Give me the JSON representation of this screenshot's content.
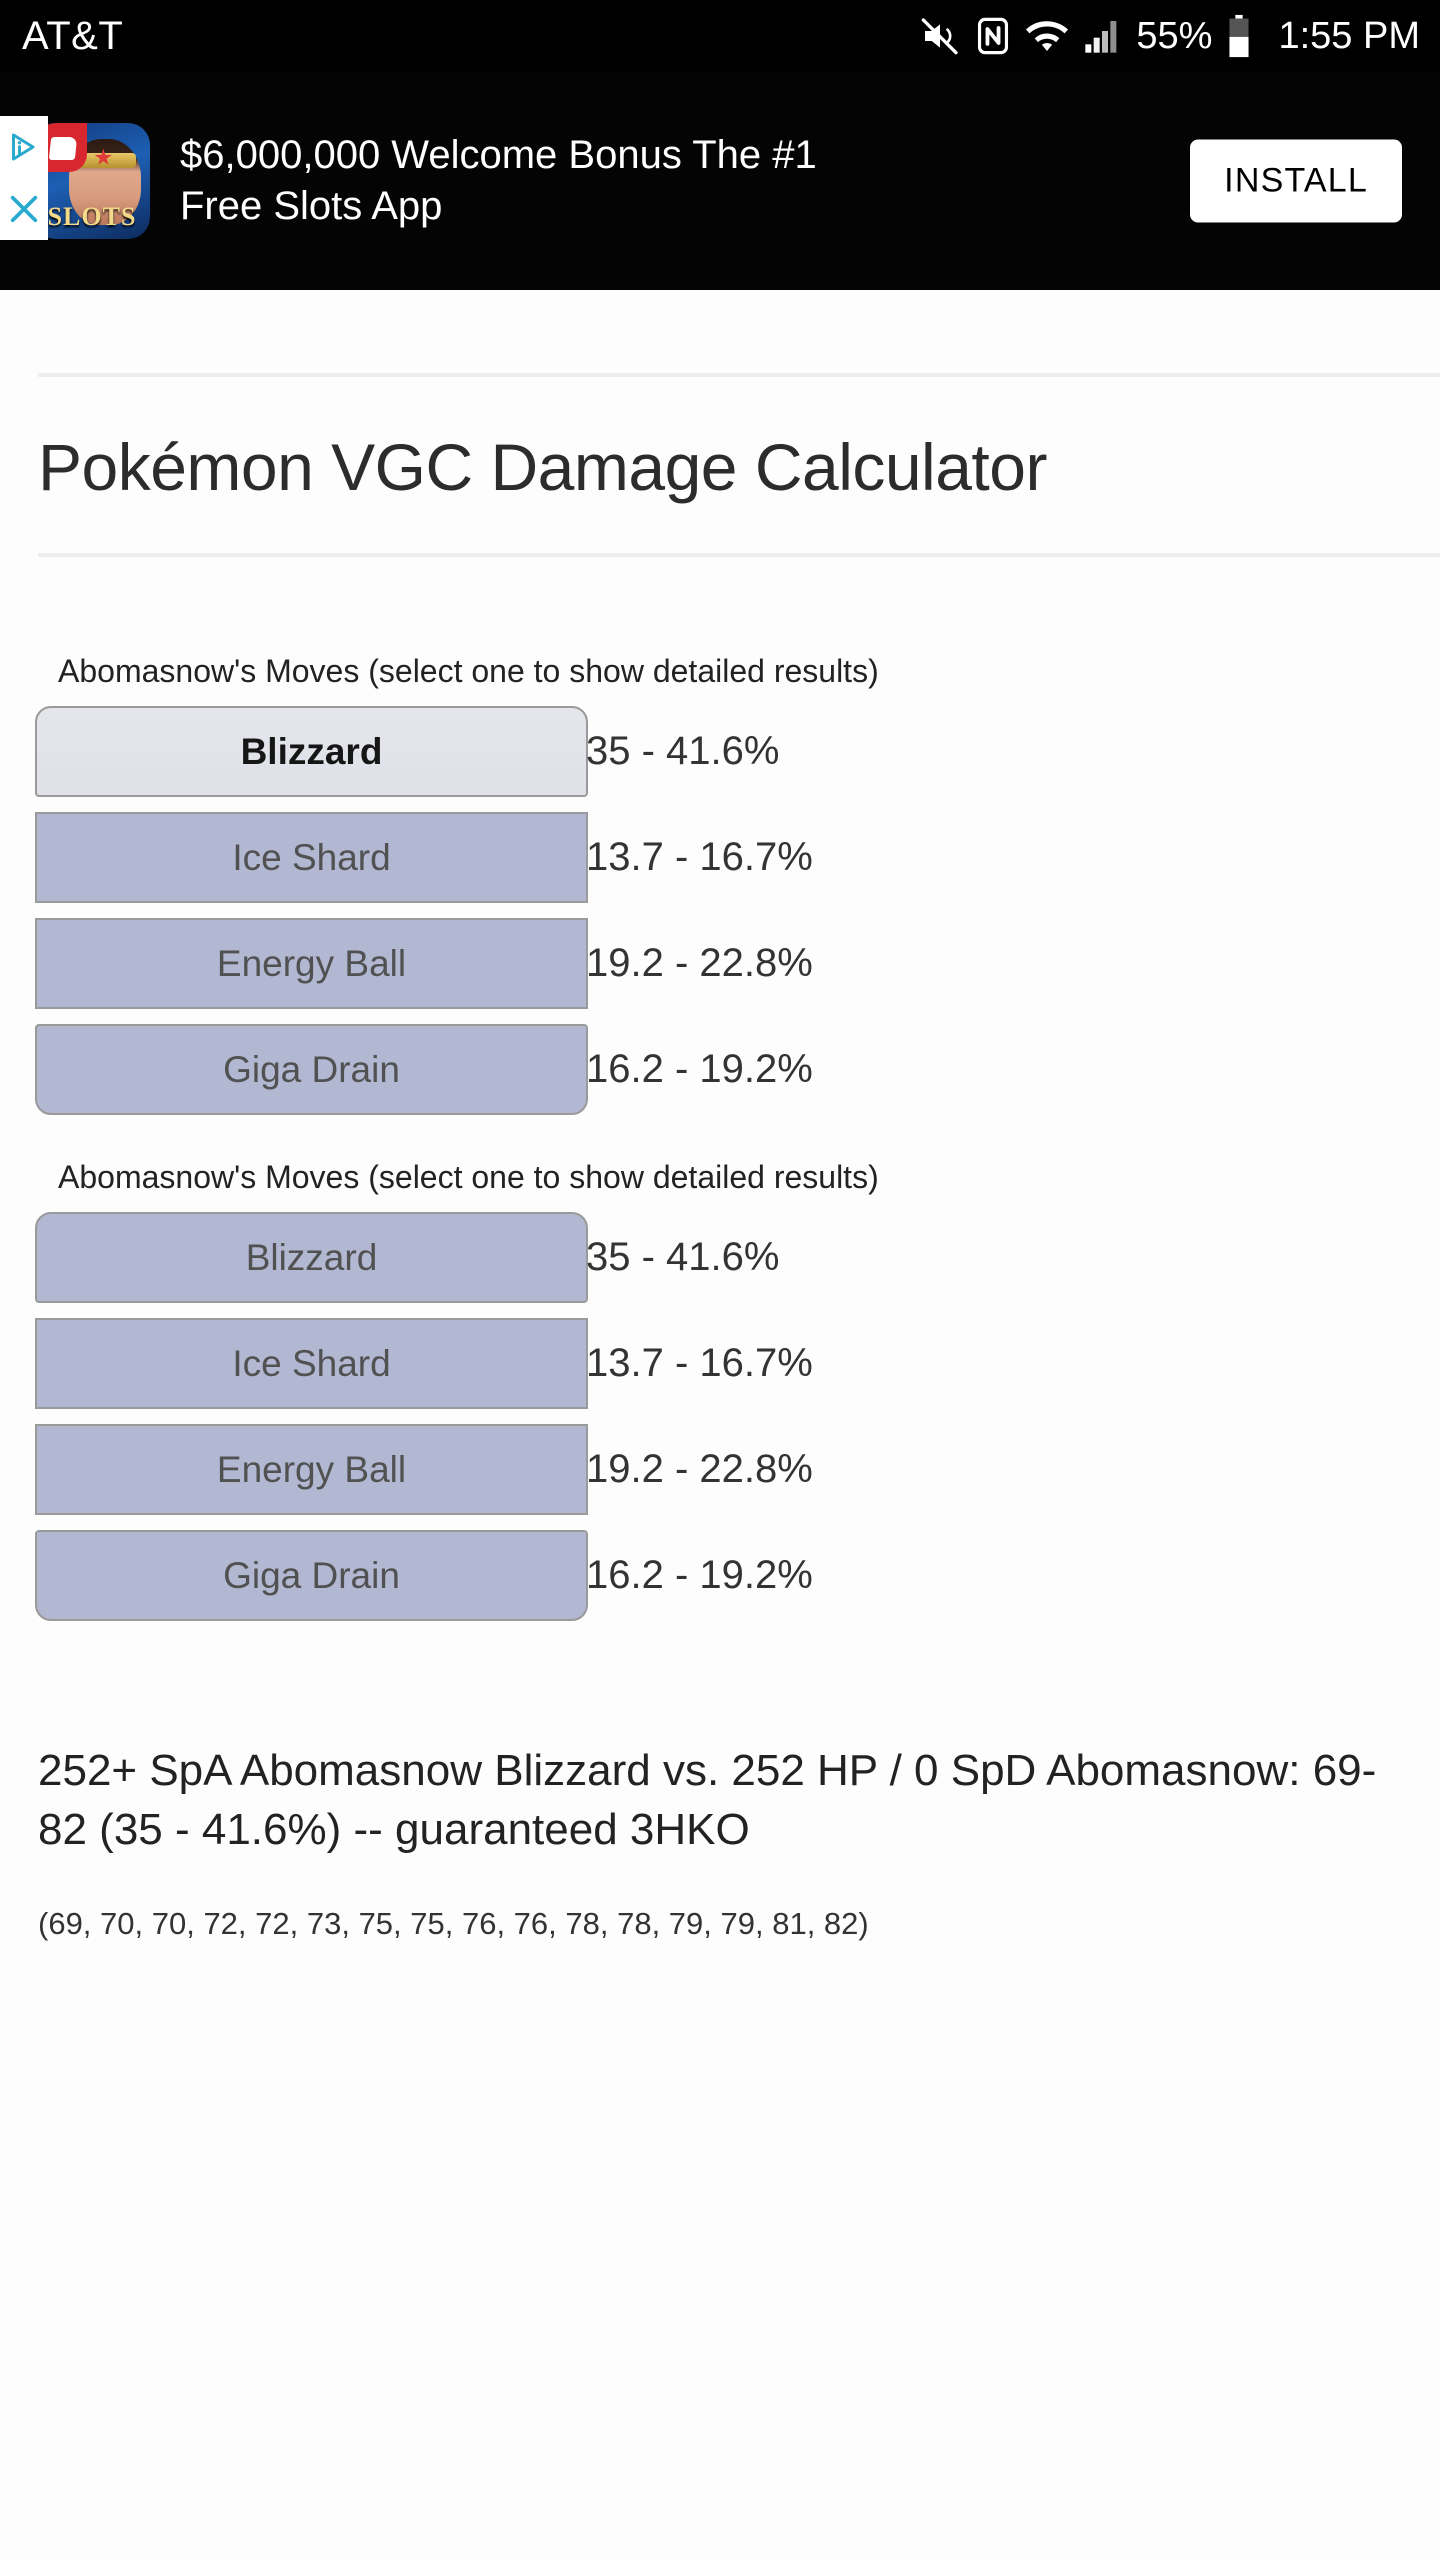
{
  "status_bar": {
    "carrier": "AT&T",
    "battery_percent": "55%",
    "time": "1:55 PM",
    "icons": [
      "mute-icon",
      "nfc-icon",
      "wifi-icon",
      "cellular-signal-icon",
      "battery-icon"
    ]
  },
  "ad": {
    "headline": "$6,000,000 Welcome Bonus The #1 Free Slots App",
    "install_label": "INSTALL",
    "app_icon_text": "SLOTS",
    "badges": [
      "adchoices-icon",
      "close-icon"
    ]
  },
  "page": {
    "title": "Pokémon VGC Damage Calculator"
  },
  "moves_sections": [
    {
      "label": "Abomasnow's Moves (select one to show detailed results)",
      "moves": [
        {
          "name": "Blizzard",
          "percent": "35 - 41.6%",
          "selected": true
        },
        {
          "name": "Ice Shard",
          "percent": "13.7 - 16.7%",
          "selected": false
        },
        {
          "name": "Energy Ball",
          "percent": "19.2 - 22.8%",
          "selected": false
        },
        {
          "name": "Giga Drain",
          "percent": "16.2 - 19.2%",
          "selected": false
        }
      ]
    },
    {
      "label": "Abomasnow's Moves (select one to show detailed results)",
      "moves": [
        {
          "name": "Blizzard",
          "percent": "35 - 41.6%",
          "selected": false
        },
        {
          "name": "Ice Shard",
          "percent": "13.7 - 16.7%",
          "selected": false
        },
        {
          "name": "Energy Ball",
          "percent": "19.2 - 22.8%",
          "selected": false
        },
        {
          "name": "Giga Drain",
          "percent": "16.2 - 19.2%",
          "selected": false
        }
      ]
    }
  ],
  "result": {
    "summary": "252+ SpA Abomasnow Blizzard vs. 252 HP / 0 SpD Abomasnow: 69-82 (35 - 41.6%) -- guaranteed 3HKO",
    "damage_rolls": "(69, 70, 70, 72, 72, 73, 75, 75, 76, 76, 78, 78, 79, 79, 81, 82)"
  },
  "colors": {
    "move_button": "#b2b7d2",
    "move_button_selected": "#e2e4ea",
    "divider": "#eeeef1",
    "status_bar_bg": "#000000",
    "ad_bg": "#040404"
  }
}
